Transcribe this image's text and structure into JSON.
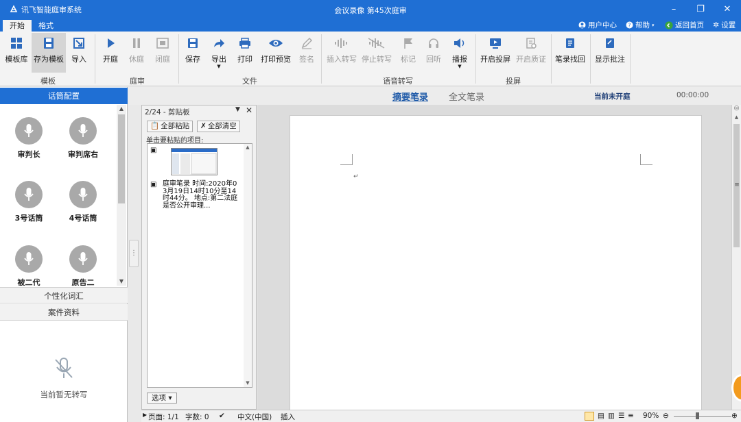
{
  "window": {
    "app_title": "讯飞智能庭审系统",
    "doc_title": "会议录像 第45次庭审",
    "controls": [
      "–",
      "❐",
      "✕"
    ]
  },
  "tabs": [
    "开始",
    "格式"
  ],
  "topright": {
    "user_center": "用户中心",
    "help": "帮助",
    "home": "返回首页",
    "settings": "设置"
  },
  "ribbon": {
    "buttons": [
      {
        "label": "模板库",
        "icon": "template-library-icon"
      },
      {
        "label": "存为模板",
        "icon": "save-as-template-icon"
      },
      {
        "label": "导入",
        "icon": "import-icon"
      },
      {
        "label": "开庭",
        "icon": "play-icon"
      },
      {
        "label": "休庭",
        "icon": "pause-icon"
      },
      {
        "label": "闭庭",
        "icon": "stop-icon"
      },
      {
        "label": "保存",
        "icon": "save-icon"
      },
      {
        "label": "导出",
        "icon": "export-icon"
      },
      {
        "label": "打印",
        "icon": "print-icon"
      },
      {
        "label": "打印预览",
        "icon": "print-preview-icon"
      },
      {
        "label": "签名",
        "icon": "sign-icon"
      },
      {
        "label": "插入转写",
        "icon": "insert-transcription-icon"
      },
      {
        "label": "停止转写",
        "icon": "stop-transcription-icon"
      },
      {
        "label": "标记",
        "icon": "flag-icon"
      },
      {
        "label": "回听",
        "icon": "headphones-icon"
      },
      {
        "label": "播报",
        "icon": "speaker-icon"
      },
      {
        "label": "开启投屏",
        "icon": "screen-cast-icon"
      },
      {
        "label": "开启质证",
        "icon": "evidence-icon"
      },
      {
        "label": "笔录找回",
        "icon": "record-recovery-icon"
      },
      {
        "label": "显示批注",
        "icon": "annotation-icon"
      }
    ],
    "groups": [
      "模板",
      "庭审",
      "文件",
      "语音转写",
      "投屏"
    ]
  },
  "left_panel": {
    "header": "话筒配置",
    "mics": [
      "审判长",
      "审判席右",
      "3号话筒",
      "4号话筒",
      "被二代",
      "原告二"
    ],
    "section_vocab": "个性化词汇",
    "section_case": "案件资料",
    "empty_text": "当前暂无转写"
  },
  "doc_header": {
    "tab_summary": "摘要笔录",
    "tab_full": "全文笔录",
    "status": "当前未开庭",
    "timer": "00:00:00"
  },
  "clipboard": {
    "title": "2/24 - 剪贴板",
    "paste_all": "全部粘贴",
    "clear_all": "全部清空",
    "hint": "单击要粘贴的项目:",
    "item_text": "庭审笔录 时间:2020年03月19日14时10分至14时44分。 地点:第二法庭 是否公开审理...",
    "options": "选项 ▾"
  },
  "status_bar": {
    "page": "页面: 1/1",
    "words": "字数: 0",
    "lang": "中文(中国)",
    "mode": "插入",
    "zoom": "90%"
  },
  "colors": {
    "titlebar": "#1f6fd4",
    "panel_header": "#1f6fd4",
    "link": "#1f5aa8"
  }
}
